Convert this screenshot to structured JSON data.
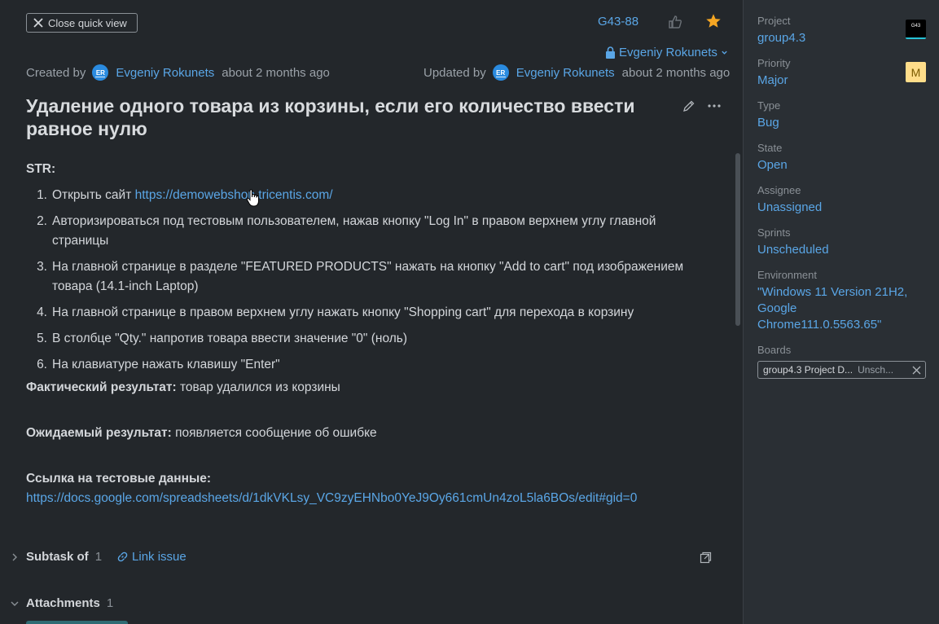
{
  "header": {
    "close_label": "Close quick view",
    "issue_id": "G43-88",
    "visibility_user": "Evgeniy Rokunets"
  },
  "meta": {
    "created_label": "Created by",
    "created_author": "Evgeniy Rokunets",
    "created_time": "about 2 months ago",
    "updated_label": "Updated by",
    "updated_author": "Evgeniy Rokunets",
    "updated_time": "about 2 months ago",
    "avatar_initials": "ER"
  },
  "issue": {
    "title": "Удаление одного товара из корзины, если его количество ввести равное нулю",
    "str_label": "STR:",
    "steps": [
      {
        "num": "1.",
        "prefix": "Открыть сайт ",
        "link": "https://demowebshop.tricentis.com/"
      },
      {
        "num": "2.",
        "text": "Авторизироваться под тестовым пользователем, нажав кнопку \"Log In\" в правом верхнем углу главной страницы"
      },
      {
        "num": "3.",
        "text": "На главной странице в разделе \"FEATURED PRODUCTS\" нажать на кнопку \"Add to cart\" под изображением товара (14.1-inch Laptop)"
      },
      {
        "num": "4.",
        "text": "На главной странице в правом верхнем углу нажать кнопку \"Shopping cart\" для перехода в корзину"
      },
      {
        "num": "5.",
        "text": "В столбце \"Qty.\" напротив товара ввести значение \"0\" (ноль)"
      },
      {
        "num": "6.",
        "text": "На клавиатуре нажать клавишу \"Enter\""
      }
    ],
    "actual_label": "Фактический результат:",
    "actual_text": " товар удалился из корзины",
    "expected_label": "Ожидаемый результат:",
    "expected_text": " появляется сообщение об ошибке",
    "testdata_label": "Ссылка на тестовые данные:",
    "testdata_link": "https://docs.google.com/spreadsheets/d/1dkVKLsy_VC9zyEHNbo0YeJ9Oy661cmUn4zoL5la6BOs/edit#gid=0"
  },
  "sections": {
    "subtask_label": "Subtask of",
    "subtask_count": "1",
    "link_issue_label": "Link issue",
    "attachments_label": "Attachments",
    "attachments_count": "1"
  },
  "sidebar": {
    "project_label": "Project",
    "project_value": "group4.3",
    "project_badge": "G43",
    "priority_label": "Priority",
    "priority_value": "Major",
    "priority_badge": "M",
    "type_label": "Type",
    "type_value": "Bug",
    "state_label": "State",
    "state_value": "Open",
    "assignee_label": "Assignee",
    "assignee_value": "Unassigned",
    "sprints_label": "Sprints",
    "sprints_value": "Unscheduled",
    "environment_label": "Environment",
    "environment_value": "\"Windows 11 Version 21H2, Google Chrome111.0.5563.65\"",
    "boards_label": "Boards",
    "board_name": "group4.3 Project D...",
    "board_sprint": "Unsch..."
  },
  "colors": {
    "accent": "#5aa6e6",
    "star": "#f5a623",
    "background": "#23272b",
    "sidebar": "#2a2f34"
  },
  "icons": [
    "close-icon",
    "thumbs-up-icon",
    "star-icon",
    "lock-icon",
    "chevron-down-icon",
    "pencil-icon",
    "more-icon",
    "chevron-right-icon",
    "link-icon",
    "open-external-icon",
    "remove-icon",
    "cursor-hand-icon"
  ]
}
